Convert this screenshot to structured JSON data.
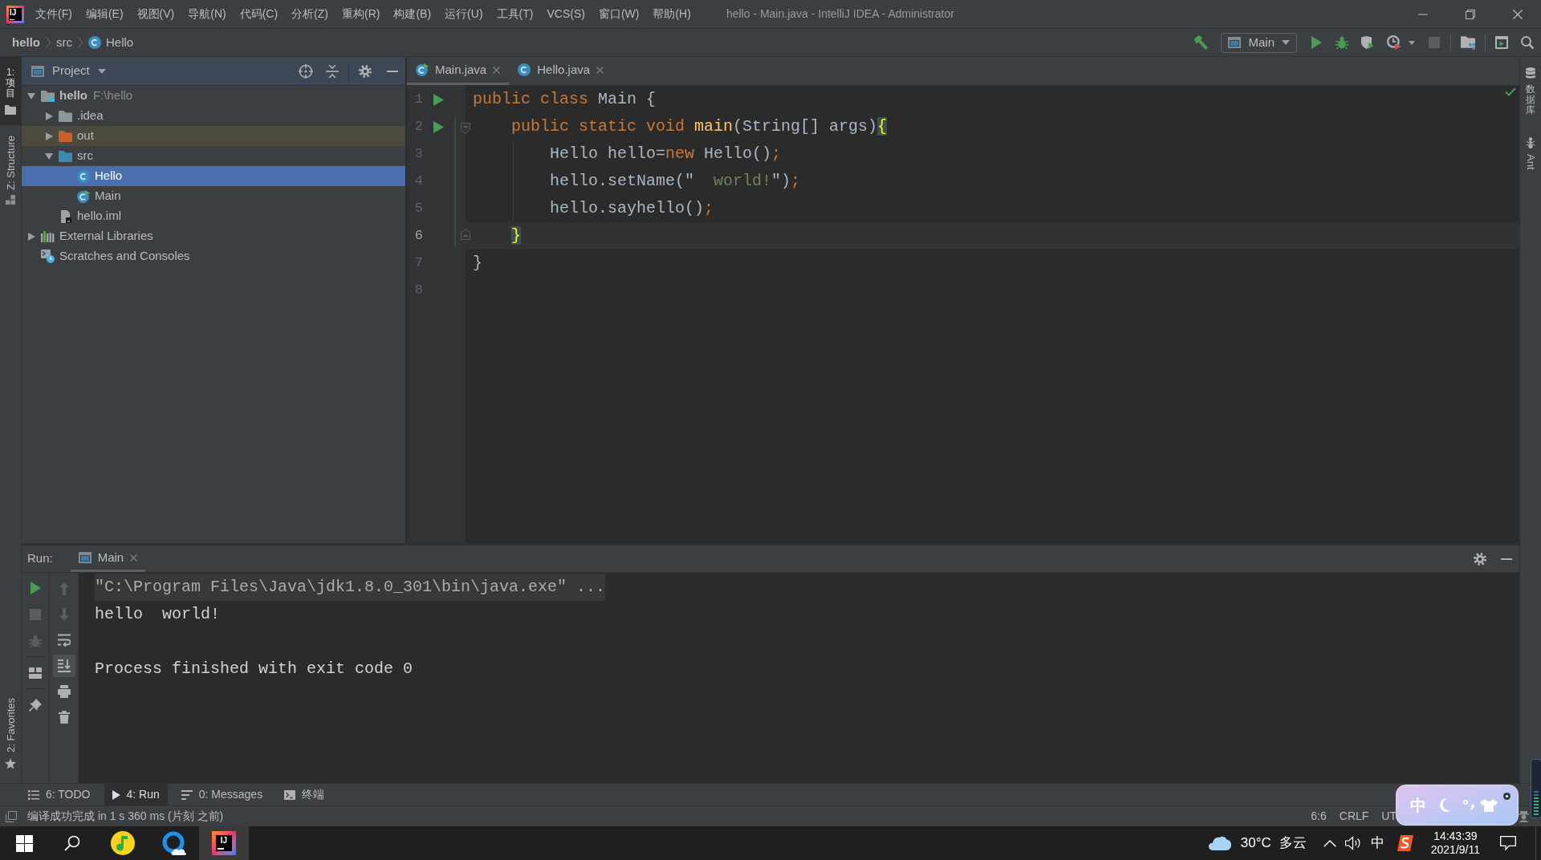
{
  "title_bar": {
    "logo": "IJ",
    "menu": [
      "文件(F)",
      "编辑(E)",
      "视图(V)",
      "导航(N)",
      "代码(C)",
      "分析(Z)",
      "重构(R)",
      "构建(B)",
      "运行(U)",
      "工具(T)",
      "VCS(S)",
      "窗口(W)",
      "帮助(H)"
    ],
    "title": "hello - Main.java - IntelliJ IDEA - Administrator"
  },
  "nav_bar": {
    "breadcrumbs": [
      {
        "label": "hello",
        "kind": "project"
      },
      {
        "label": "src",
        "kind": "folder"
      },
      {
        "label": "Hello",
        "kind": "class"
      }
    ],
    "toolbar": [
      [
        {
          "kind": "build",
          "disabled": false
        },
        {
          "kind": "run-config",
          "label": "Main",
          "disabled": false
        },
        {
          "kind": "run",
          "disabled": false
        },
        {
          "kind": "debug",
          "disabled": false
        },
        {
          "kind": "coverage",
          "disabled": false
        },
        {
          "kind": "profile",
          "disabled": false
        },
        {
          "kind": "stop",
          "disabled": true
        }
      ],
      [
        {
          "kind": "project-structure",
          "disabled": false
        }
      ],
      [
        {
          "kind": "run-window",
          "disabled": false
        },
        {
          "kind": "search",
          "disabled": false
        }
      ]
    ]
  },
  "left_strip": {
    "top": [
      {
        "label": "1: 项目",
        "kind": "project",
        "selected": true
      },
      {
        "label": "Z: Structure",
        "kind": "structure",
        "selected": false
      }
    ],
    "bottom": [
      {
        "label": "2: Favorites",
        "kind": "favorites",
        "selected": false
      }
    ]
  },
  "right_strip": [
    {
      "label": "数据库",
      "kind": "database",
      "selected": false
    },
    {
      "label": "Ant",
      "kind": "ant",
      "selected": false
    }
  ],
  "project": {
    "title": "Project",
    "tree": [
      {
        "label": "hello",
        "path": "F:\\hello",
        "kind": "module",
        "expanded": true,
        "selected": false,
        "children": [
          {
            "label": ".idea",
            "kind": "folder",
            "expanded": false,
            "selected": false
          },
          {
            "label": "out",
            "kind": "excluded-folder",
            "expanded": false,
            "selected": false
          },
          {
            "label": "src",
            "kind": "source-folder",
            "expanded": true,
            "selected": false,
            "children": [
              {
                "label": "Hello",
                "kind": "class",
                "selected": true
              },
              {
                "label": "Main",
                "kind": "main-class",
                "selected": false
              }
            ]
          },
          {
            "label": "hello.iml",
            "kind": "module-file",
            "selected": false
          }
        ]
      },
      {
        "label": "External Libraries",
        "kind": "libraries",
        "expanded": false,
        "selected": false
      },
      {
        "label": "Scratches and Consoles",
        "kind": "scratches",
        "selected": false
      }
    ]
  },
  "editor": {
    "tabs": [
      {
        "label": "Main.java",
        "kind": "main-class",
        "selected": true
      },
      {
        "label": "Hello.java",
        "kind": "class",
        "selected": false
      }
    ],
    "lines": [
      {
        "number": "1",
        "kind": "plain",
        "run": true,
        "current": false,
        "tokens": [
          {
            "kind": "keyword",
            "text": "public class "
          },
          {
            "kind": "plain",
            "text": "Main {"
          }
        ]
      },
      {
        "number": "2",
        "kind": "fold-start",
        "run": true,
        "current": false,
        "tokens": [
          {
            "kind": "keyword",
            "text": "    public static void "
          },
          {
            "kind": "method",
            "text": "main"
          },
          {
            "kind": "plain",
            "text": "(String[] args)"
          },
          {
            "kind": "brace",
            "text": "{"
          }
        ]
      },
      {
        "number": "3",
        "kind": "plain",
        "run": false,
        "current": false,
        "tokens": [
          {
            "kind": "plain",
            "text": "        Hello hello="
          },
          {
            "kind": "keyword",
            "text": "new"
          },
          {
            "kind": "plain",
            "text": " Hello()"
          },
          {
            "kind": "punct",
            "text": ";"
          }
        ]
      },
      {
        "number": "4",
        "kind": "plain",
        "run": false,
        "current": false,
        "tokens": [
          {
            "kind": "plain",
            "text": "        hello.setName(\""
          },
          {
            "kind": "string",
            "text": "  world!"
          },
          {
            "kind": "plain",
            "text": "\")"
          },
          {
            "kind": "punct",
            "text": ";"
          }
        ]
      },
      {
        "number": "5",
        "kind": "plain",
        "run": false,
        "current": false,
        "tokens": [
          {
            "kind": "plain",
            "text": "        hello.sayhello()"
          },
          {
            "kind": "punct",
            "text": ";"
          }
        ]
      },
      {
        "number": "6",
        "kind": "fold-end",
        "run": false,
        "current": true,
        "tokens": [
          {
            "kind": "brace",
            "text": "    }"
          }
        ]
      },
      {
        "number": "7",
        "kind": "plain",
        "run": false,
        "current": false,
        "tokens": [
          {
            "kind": "plain",
            "text": "}"
          }
        ]
      },
      {
        "number": "8",
        "kind": "plain",
        "run": false,
        "current": false
      }
    ]
  },
  "run_panel": {
    "label": "Run:",
    "tabs": [
      {
        "label": "Main",
        "selected": true
      }
    ],
    "toolbar_left": [
      [
        {
          "kind": "rerun",
          "disabled": false
        },
        {
          "kind": "stop",
          "disabled": true
        },
        {
          "kind": "debug",
          "disabled": true
        }
      ],
      [
        {
          "kind": "layout",
          "disabled": false
        }
      ],
      [
        {
          "kind": "pin",
          "disabled": false
        }
      ]
    ],
    "toolbar_right": [
      [
        {
          "kind": "up",
          "disabled": true,
          "on": false
        },
        {
          "kind": "down",
          "disabled": true,
          "on": false
        },
        {
          "kind": "soft-wrap",
          "disabled": false,
          "on": false
        },
        {
          "kind": "scroll-to-end",
          "disabled": false,
          "on": true
        },
        {
          "kind": "print",
          "disabled": false,
          "on": false
        },
        {
          "kind": "clear",
          "disabled": false,
          "on": false
        }
      ]
    ],
    "console": [
      {
        "kind": "command",
        "text": "\"C:\\Program Files\\Java\\jdk1.8.0_301\\bin\\java.exe\" ..."
      },
      {
        "kind": "output",
        "text": "hello  world!"
      },
      {
        "kind": "exit",
        "text": "Process finished with exit code 0"
      }
    ]
  },
  "bottom_tabs": [
    {
      "label": "6: TODO",
      "kind": "todo",
      "selected": false
    },
    {
      "label": "4: Run",
      "kind": "run",
      "selected": true
    },
    {
      "label": "0: Messages",
      "kind": "messages",
      "selected": false
    },
    {
      "label": "终端",
      "kind": "terminal",
      "selected": false
    }
  ],
  "status_bar": {
    "message": "编译成功完成 in 1 s 360 ms (片刻 之前)",
    "position": "6:6",
    "line_separator": "CRLF",
    "encoding": "UT"
  },
  "ime_toolbar": {
    "mode": "中"
  },
  "taskbar": {
    "apps": [
      {
        "kind": "music",
        "selected": false
      },
      {
        "kind": "browser",
        "selected": false
      },
      {
        "kind": "ide",
        "logo": "IJ",
        "selected": true
      }
    ],
    "weather": {
      "temperature": "30°C",
      "condition": "多云"
    },
    "input_mode": "中",
    "time": "14:43:39",
    "date": "2021/9/11"
  }
}
